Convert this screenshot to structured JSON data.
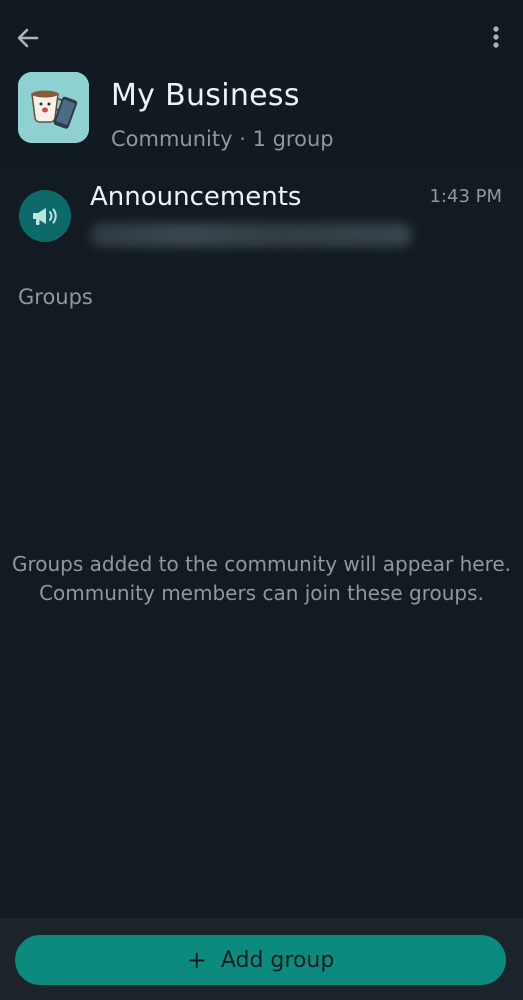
{
  "header": {
    "title": "My Business",
    "subtitle": "Community · 1 group"
  },
  "icons": {
    "back": "arrow-left-icon",
    "menu": "more-vertical-icon",
    "community_avatar": "coffee-cup-phone-avatar",
    "announcements": "megaphone-icon",
    "add": "plus-icon"
  },
  "announcements": {
    "title": "Announcements",
    "time": "1:43 PM"
  },
  "groups_section": {
    "label": "Groups",
    "empty_line1": "Groups added to the community will appear here.",
    "empty_line2": "Community members can join these groups."
  },
  "actions": {
    "add_group_label": "Add group",
    "plus_glyph": "+"
  },
  "colors": {
    "background": "#121b22",
    "accent": "#0b8a7d",
    "announcement_avatar": "#0e6a68"
  }
}
